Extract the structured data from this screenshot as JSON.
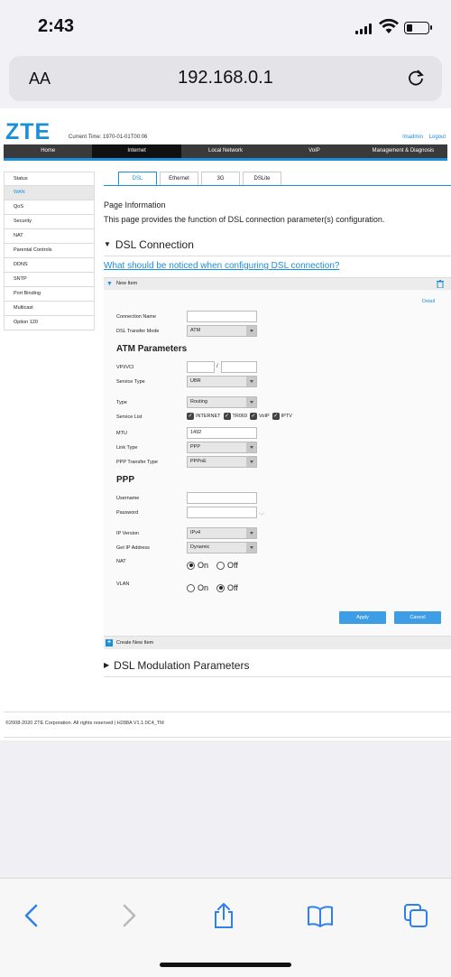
{
  "status_bar": {
    "time": "2:43"
  },
  "browser": {
    "text_size_label": "AA",
    "url": "192.168.0.1"
  },
  "router": {
    "logo": "ZTE",
    "current_time": "Current Time: 1970-01-01T00:06",
    "user": "lmadmin",
    "logout": "Logout",
    "top_nav": [
      "Home",
      "Internet",
      "Local Network",
      "VoIP",
      "Management & Diagnosis"
    ],
    "active_top_nav": "Internet",
    "sidebar": [
      "Status",
      "WAN",
      "QoS",
      "Security",
      "NAT",
      "Parental Controls",
      "DDNS",
      "SNTP",
      "Port Binding",
      "Multicast",
      "Option 120"
    ],
    "active_sidebar": "WAN",
    "tabs": [
      "DSL",
      "Ethernet",
      "3G",
      "DSLite"
    ],
    "active_tab": "DSL",
    "page_info_title": "Page Information",
    "page_info_text": "This page provides the function of DSL connection parameter(s) configuration.",
    "dsl_connection_heading": "DSL Connection",
    "notice_link": "What should be noticed when configuring DSL connection?",
    "new_item_label": "New Item",
    "detail_link": "Detail",
    "form": {
      "connection_name_label": "Connection Name",
      "connection_name_value": "",
      "transfer_mode_label": "DSL Transfer Mode",
      "transfer_mode_value": "ATM",
      "atm_heading": "ATM Parameters",
      "vpi_vci_label": "VPI/VCI",
      "vpi_value": "",
      "vci_value": "",
      "vpi_separator": "/",
      "service_type_label": "Service Type",
      "service_type_value": "UBR",
      "type_label": "Type",
      "type_value": "Routing",
      "service_list_label": "Service List",
      "service_list": [
        "INTERNET",
        "TR069",
        "VoIP",
        "IPTV"
      ],
      "mtu_label": "MTU",
      "mtu_value": "1492",
      "link_type_label": "Link Type",
      "link_type_value": "PPP",
      "ppp_transfer_label": "PPP Transfer Type",
      "ppp_transfer_value": "PPPoE",
      "ppp_heading": "PPP",
      "username_label": "Username",
      "username_value": "",
      "password_label": "Password",
      "password_value": "",
      "ip_version_label": "IP Version",
      "ip_version_value": "IPv4",
      "get_ip_label": "Get IP Address",
      "get_ip_value": "Dynamic",
      "nat_label": "NAT",
      "nat_on": "On",
      "nat_off": "Off",
      "nat_selected": "On",
      "vlan_label": "VLAN",
      "vlan_on": "On",
      "vlan_off": "Off",
      "vlan_selected": "Off",
      "apply_label": "Apply",
      "cancel_label": "Cancel"
    },
    "create_new_item": "Create New Item",
    "modulation_heading": "DSL Modulation Parameters",
    "footer": "©2008-2020 ZTE Corporation. All rights reserved  |   H288A V1.1.0C4_TM"
  },
  "colors": {
    "accent": "#1a8fd8",
    "button": "#3d9ee6",
    "nav": "#3a3a3a"
  },
  "toolbar_icons": [
    "back-icon",
    "forward-icon",
    "share-icon",
    "bookmarks-icon",
    "tabs-icon"
  ]
}
